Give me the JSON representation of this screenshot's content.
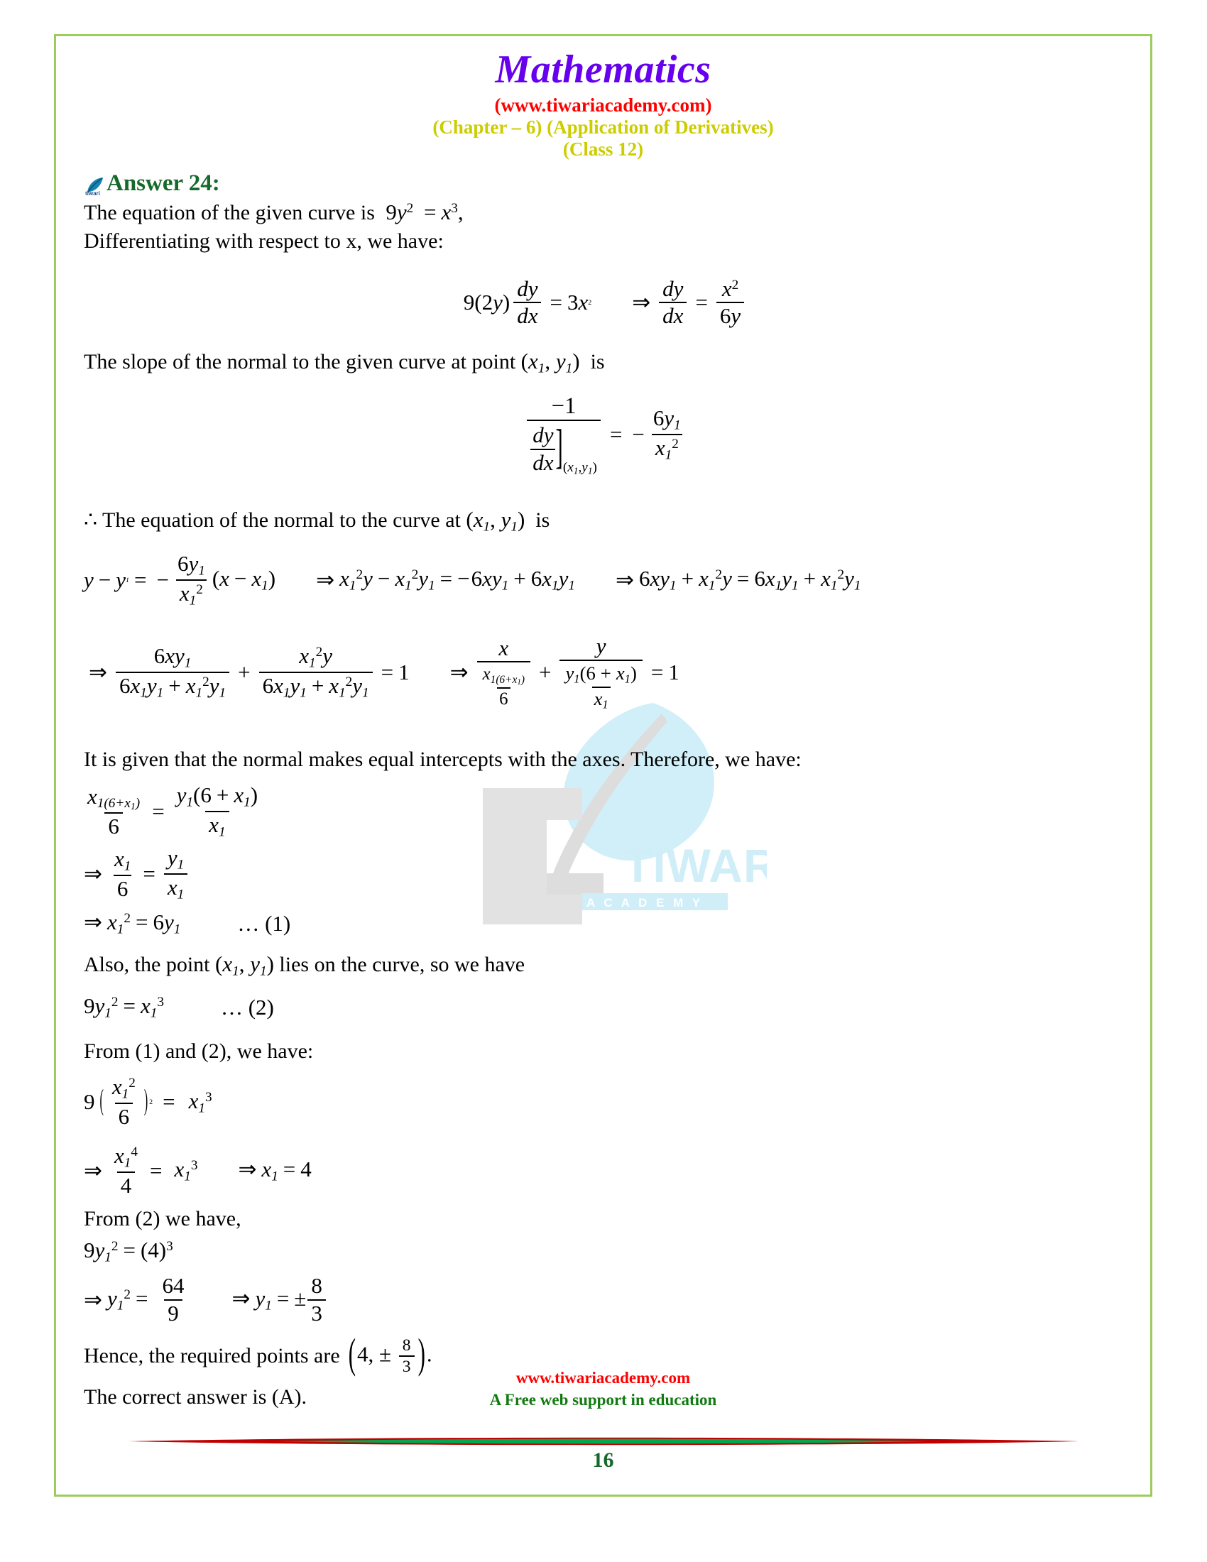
{
  "header": {
    "title": "Mathematics",
    "site_url": "(www.tiwariacademy.com)",
    "chapter": "(Chapter – 6) (Application of Derivatives)",
    "class": "(Class 12)",
    "title_color": "#6600ee",
    "url_color": "#ff0000",
    "chapter_color": "#cccc00"
  },
  "answer": {
    "heading": "Answer 24:",
    "heading_color": "#17692b",
    "icon": "quill-feather-icon",
    "line_curve_prefix": "The equation of the given curve is",
    "curve_equation": "9y² = x³,",
    "line_differentiate": "Differentiating with respect to x, we have:",
    "eq1": {
      "left": "9(2y)",
      "dy": "dy",
      "dx": "dx",
      "equals": "=",
      "rhs": "3x²",
      "implies": "⇒",
      "dy2": "dy",
      "dx2": "dx",
      "equals2": "=",
      "frac_num": "x²",
      "frac_den": "6y"
    },
    "line_slope": "The slope of the normal to the given curve at point (x₁, y₁)  is",
    "eq2": {
      "num": "−1",
      "den_dy": "dy",
      "den_dx": "dx",
      "subscript": "(x₁,y₁)",
      "equals": "=",
      "minus": "−",
      "rhs_num": "6y₁",
      "rhs_den": "x₁²"
    },
    "line_normal_eq": "∴ The equation of the normal to the curve at (x₁, y₁)  is",
    "eq3": {
      "part1_lhs": "y − y₁ =",
      "part1_minus": "−",
      "part1_num": "6y₁",
      "part1_den": "x₁²",
      "part1_tail": "(x − x₁)",
      "part2": "⇒ x₁²y − x₁²y₁ = −6xy₁ + 6x₁y₁",
      "part3": "⇒ 6xy₁ + x₁²y = 6x₁y₁ + x₁²y₁"
    },
    "eq4": {
      "implies": "⇒",
      "f1_num": "6xy₁",
      "f1_den": "6x₁y₁ + x₁²y₁",
      "plus": "+",
      "f2_num": "x₁²y",
      "f2_den": "6x₁y₁ + x₁²y₁",
      "equals": "= 1",
      "implies2": "⇒",
      "g1_num": "x",
      "g1_den_num": "x₁(6+x₁)",
      "g1_den_den": "6",
      "plus2": "+",
      "g2_num": "y",
      "g2_den_num": "y₁(6 + x₁)",
      "g2_den_den": "x₁",
      "equals2": "= 1"
    },
    "line_intercepts": "It is given that the normal makes equal intercepts with the axes. Therefore, we have:",
    "eq5": {
      "lhs_num_num": "x₁(6+x₁)",
      "lhs_num_den": "6",
      "equals": "=",
      "rhs_num_num": "y₁(6 + x₁)",
      "rhs_num_den": "x₁"
    },
    "eq6": {
      "implies": "⇒",
      "lhs_num": "x₁",
      "lhs_den": "6",
      "equals": "=",
      "rhs_num": "y₁",
      "rhs_den": "x₁"
    },
    "eq7": {
      "text": "⇒ x₁² = 6y₁",
      "ref": "… (1)"
    },
    "line_also": "Also, the point (x₁, y₁) lies on the curve, so we have",
    "eq8": {
      "text": "9y₁² = x₁³",
      "ref": "… (2)"
    },
    "line_from12": "From (1) and (2), we have:",
    "eq9": {
      "nine": "9",
      "inner_num": "x₁²",
      "inner_den": "6",
      "power": "2",
      "equals": "=",
      "rhs": "x₁³"
    },
    "eq10": {
      "implies": "⇒",
      "num": "x₁⁴",
      "den": "4",
      "equals": "=",
      "rhs": "x₁³",
      "implies2": "⇒ x₁ = 4"
    },
    "line_from2": "From (2) we have,",
    "eq11": "9y₁² = (4)³",
    "eq12": {
      "implies": "⇒",
      "lhs": "y₁² =",
      "num": "64",
      "den": "9",
      "implies2": "⇒",
      "rhs_lhs": "y₁ = ±",
      "rhs_num": "8",
      "rhs_den": "3"
    },
    "line_hence_prefix": "Hence, the required points are",
    "hence_point_open": "4, ±",
    "hence_num": "8",
    "hence_den": "3",
    "hence_suffix": ".",
    "line_correct": "The correct answer is (A)."
  },
  "footer": {
    "url": "www.tiwariacademy.com",
    "tagline": "A Free web support in education",
    "page_number": "16",
    "url_color": "#ff0000",
    "tagline_color": "#117a11",
    "page_number_color": "#17692b"
  },
  "watermark": {
    "brand": "TIWARI",
    "sub": "A C A D E M Y"
  }
}
